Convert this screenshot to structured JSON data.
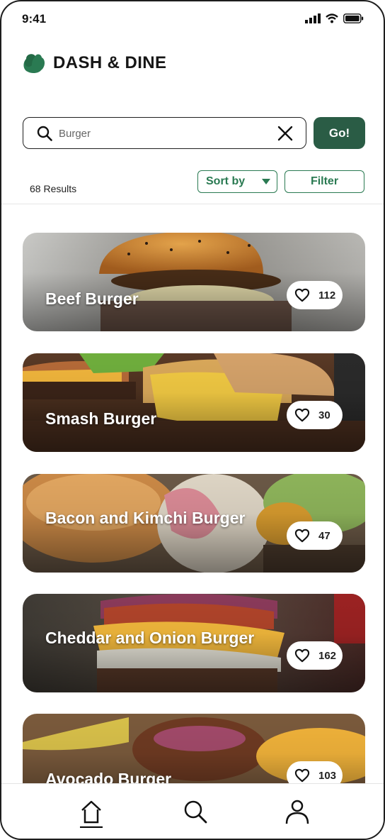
{
  "status": {
    "time": "9:41"
  },
  "brand": {
    "title": "DASH & DINE",
    "color": "#2a7a52"
  },
  "search": {
    "value": "Burger",
    "go_label": "Go!"
  },
  "results": {
    "count_label": "68 Results",
    "sort_label": "Sort by",
    "filter_label": "Filter"
  },
  "cards": [
    {
      "title": "Beef Burger",
      "likes": "112"
    },
    {
      "title": "Smash Burger",
      "likes": "30"
    },
    {
      "title": "Bacon and Kimchi Burger",
      "likes": "47"
    },
    {
      "title": "Cheddar and Onion Burger",
      "likes": "162"
    },
    {
      "title": "Avocado Burger",
      "likes": "103"
    }
  ],
  "nav": {
    "items": [
      "home-icon",
      "search-icon",
      "profile-icon"
    ]
  },
  "colors": {
    "accent": "#2a5c45",
    "outline": "#2a7a52"
  }
}
